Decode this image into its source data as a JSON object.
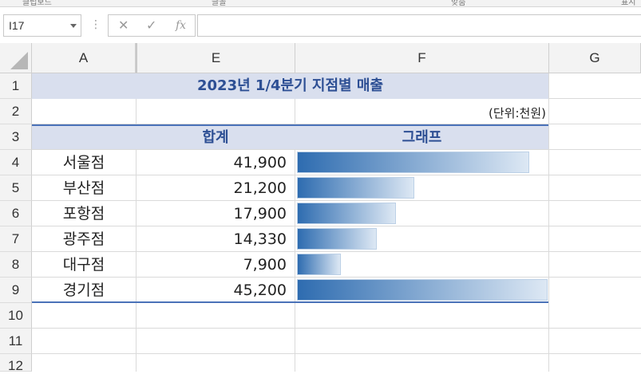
{
  "ribbon_fragments": [
    "클립보드",
    "글꼴",
    "맞춤",
    "표시"
  ],
  "formula_bar": {
    "name_box": "I17",
    "cancel_icon": "✕",
    "enter_icon": "✓",
    "fx_label": "fx",
    "formula": ""
  },
  "columns": [
    "A",
    "E",
    "F",
    "G"
  ],
  "rows": [
    "1",
    "2",
    "3",
    "4",
    "5",
    "6",
    "7",
    "8",
    "9",
    "10",
    "11",
    "12"
  ],
  "sheet": {
    "title": "2023년 1/4분기 지점별 매출",
    "unit_note": "(단위:천원)",
    "header_total": "합계",
    "header_graph": "그래프",
    "items": [
      {
        "name": "서울점",
        "total": "41,900",
        "value": 41900
      },
      {
        "name": "부산점",
        "total": "21,200",
        "value": 21200
      },
      {
        "name": "포항점",
        "total": "17,900",
        "value": 17900
      },
      {
        "name": "광주점",
        "total": "14,330",
        "value": 14330
      },
      {
        "name": "대구점",
        "total": "7,900",
        "value": 7900
      },
      {
        "name": "경기점",
        "total": "45,200",
        "value": 45200
      }
    ],
    "bar_max": 45200,
    "bar_color_start": "#2e6cb0",
    "bar_color_end": "#dde8f4",
    "band_color": "#d9dfee",
    "accent_color": "#2d4f94"
  }
}
